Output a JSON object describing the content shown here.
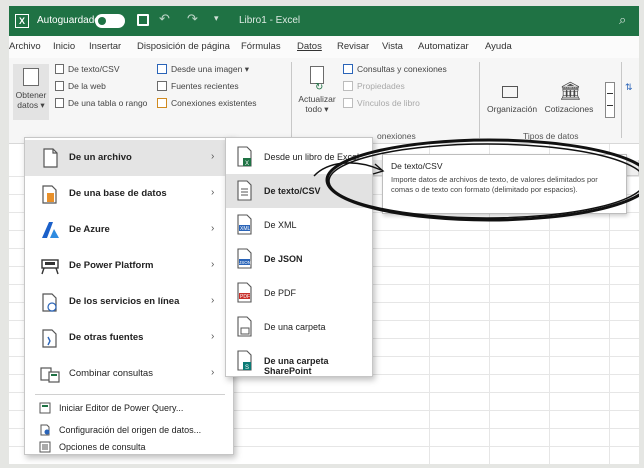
{
  "titlebar": {
    "app_icon_letter": "X",
    "autosave_label": "Autoguardado",
    "document_title": "Libro1 - Excel",
    "color": "#1f7244"
  },
  "tabs": [
    {
      "label": "Archivo"
    },
    {
      "label": "Inicio"
    },
    {
      "label": "Insertar"
    },
    {
      "label": "Disposición de página"
    },
    {
      "label": "Fórmulas"
    },
    {
      "label": "Datos",
      "active": true
    },
    {
      "label": "Revisar"
    },
    {
      "label": "Vista"
    },
    {
      "label": "Automatizar"
    },
    {
      "label": "Ayuda"
    }
  ],
  "ribbon": {
    "get_data": {
      "line1": "Obtener",
      "line2": "datos ▾"
    },
    "small_left": [
      "De texto/CSV",
      "De la web",
      "De una tabla o rango"
    ],
    "small_mid": [
      "Desde una imagen ▾",
      "Fuentes recientes",
      "Conexiones existentes"
    ],
    "refresh": {
      "line1": "Actualizar",
      "line2": "todo ▾"
    },
    "small_queries": [
      "Consultas y conexiones",
      "Propiedades",
      "Vínculos de libro"
    ],
    "group_queries": "onexiones",
    "org_label": "Organización",
    "quotes_label": "Cotizaciones",
    "group_types": "Tipos de datos"
  },
  "menu1": {
    "items": [
      {
        "label": "De un archivo",
        "icon": "file-icon",
        "has_submenu": true
      },
      {
        "label": "De una base de datos",
        "icon": "database-icon",
        "has_submenu": true
      },
      {
        "label": "De Azure",
        "icon": "azure-icon",
        "has_submenu": true
      },
      {
        "label": "De Power Platform",
        "icon": "power-platform-icon",
        "has_submenu": true
      },
      {
        "label": "De los servicios en línea",
        "icon": "online-services-icon",
        "has_submenu": true
      },
      {
        "label": "De otras fuentes",
        "icon": "other-sources-icon",
        "has_submenu": true
      },
      {
        "label": "Combinar consultas",
        "icon": "combine-icon",
        "has_submenu": true
      }
    ],
    "small_items": [
      {
        "label": "Iniciar Editor de Power Query...",
        "icon": "power-query-icon"
      },
      {
        "label": "Configuración del origen de datos...",
        "icon": "data-source-icon"
      },
      {
        "label": "Opciones de consulta",
        "icon": "query-options-icon"
      }
    ]
  },
  "menu2": {
    "items": [
      {
        "label": "Desde un libro de Excel",
        "icon": "excel-workbook-icon"
      },
      {
        "label": "De texto/CSV",
        "icon": "text-csv-icon",
        "highlighted": true
      },
      {
        "label": "De XML",
        "icon": "xml-icon"
      },
      {
        "label": "De JSON",
        "icon": "json-icon"
      },
      {
        "label": "De PDF",
        "icon": "pdf-icon"
      },
      {
        "label": "De una carpeta",
        "icon": "folder-icon"
      },
      {
        "label": "De una carpeta SharePoint",
        "icon": "sharepoint-folder-icon"
      }
    ]
  },
  "tooltip": {
    "title": "De texto/CSV",
    "body": "Importe datos de archivos de texto, de valores delimitados por comas o de texto con formato (delimitado por espacios)."
  },
  "colors": {
    "excel_green": "#1f7244",
    "azure_blue": "#1b60c9",
    "pdf_red": "#c8302b",
    "excel_tile": "#1f7244",
    "sharepoint_teal": "#0b7a75",
    "database_orange": "#e8902a"
  }
}
